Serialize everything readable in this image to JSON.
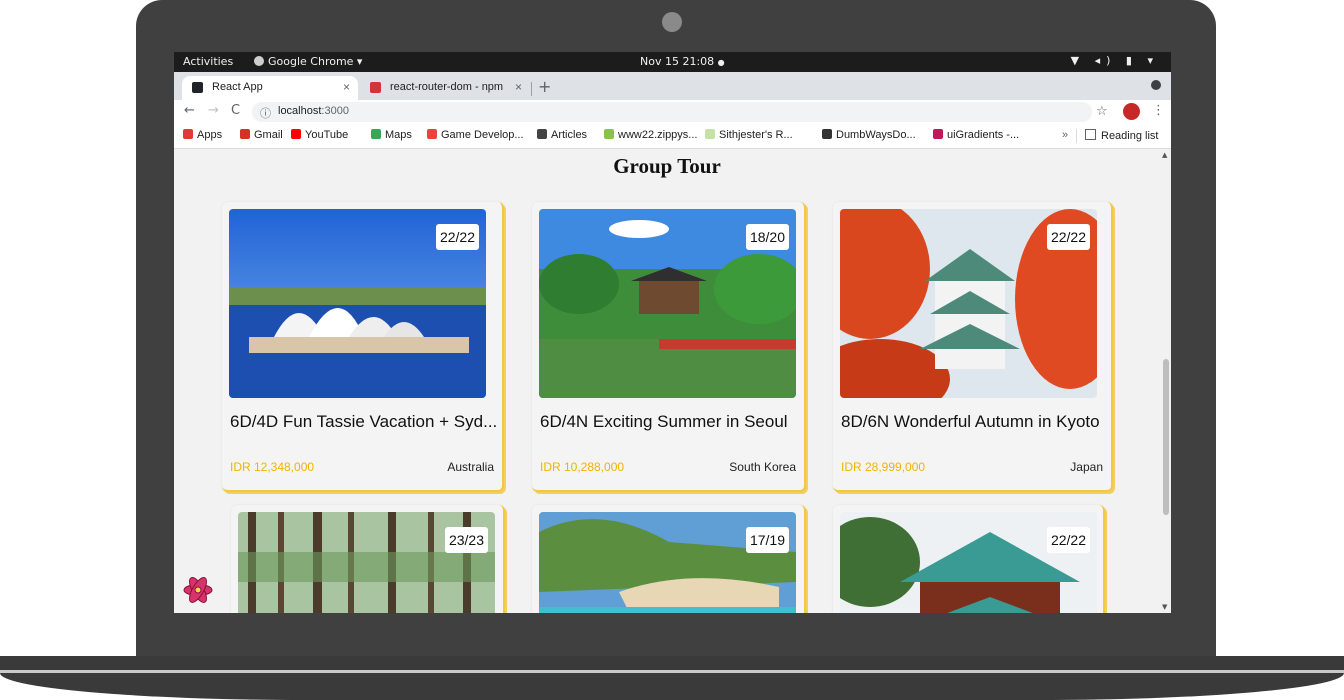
{
  "os_bar": {
    "activities": "Activities",
    "app_menu": "Google Chrome ▾",
    "clock": "Nov 15  21:08",
    "tray": "▼ ◂) ▮ ▾"
  },
  "browser": {
    "tabs": [
      {
        "label": "React App",
        "close": "×"
      },
      {
        "label": "react-router-dom - npm",
        "close": "×"
      }
    ],
    "new_tab": "+",
    "nav": {
      "back": "←",
      "forward": "→",
      "reload": "C"
    },
    "url_host": "localhost",
    "url_port": ":3000",
    "bookmarks": [
      {
        "label": "Apps",
        "icon": "apps-grid-icon",
        "color": "#e53935"
      },
      {
        "label": "Gmail",
        "icon": "gmail-icon",
        "color": "#d93025"
      },
      {
        "label": "YouTube",
        "icon": "youtube-icon",
        "color": "#ff0000"
      },
      {
        "label": "Maps",
        "icon": "maps-icon",
        "color": "#34a853"
      },
      {
        "label": "Game Develop...",
        "icon": "game-icon",
        "color": "#e8453c"
      },
      {
        "label": "Articles",
        "icon": "articles-icon",
        "color": "#444444"
      },
      {
        "label": "www22.zippys...",
        "icon": "zippy-icon",
        "color": "#8bc34a"
      },
      {
        "label": "Sithjester's R...",
        "icon": "sith-icon",
        "color": "#c5e1a5"
      },
      {
        "label": "DumbWaysDo...",
        "icon": "dumbways-icon",
        "color": "#333333"
      },
      {
        "label": "uiGradients -...",
        "icon": "uigradients-icon",
        "color": "#c2185b"
      }
    ],
    "bookmarks_more": "»",
    "reading_list": "Reading list"
  },
  "page": {
    "title": "Group Tour",
    "accent": "#f0b400",
    "cards": [
      {
        "quota": "22/22",
        "title": "6D/4D Fun Tassie Vacation + Syd...",
        "price": "IDR 12,348,000",
        "country": "Australia"
      },
      {
        "quota": "18/20",
        "title": "6D/4N Exciting Summer in Seoul",
        "price": "IDR 10,288,000",
        "country": "South Korea"
      },
      {
        "quota": "22/22",
        "title": "8D/6N Wonderful Autumn in Kyoto",
        "price": "IDR 28,999,000",
        "country": "Japan"
      },
      {
        "quota": "23/23"
      },
      {
        "quota": "17/19"
      },
      {
        "quota": "22/22"
      }
    ]
  }
}
